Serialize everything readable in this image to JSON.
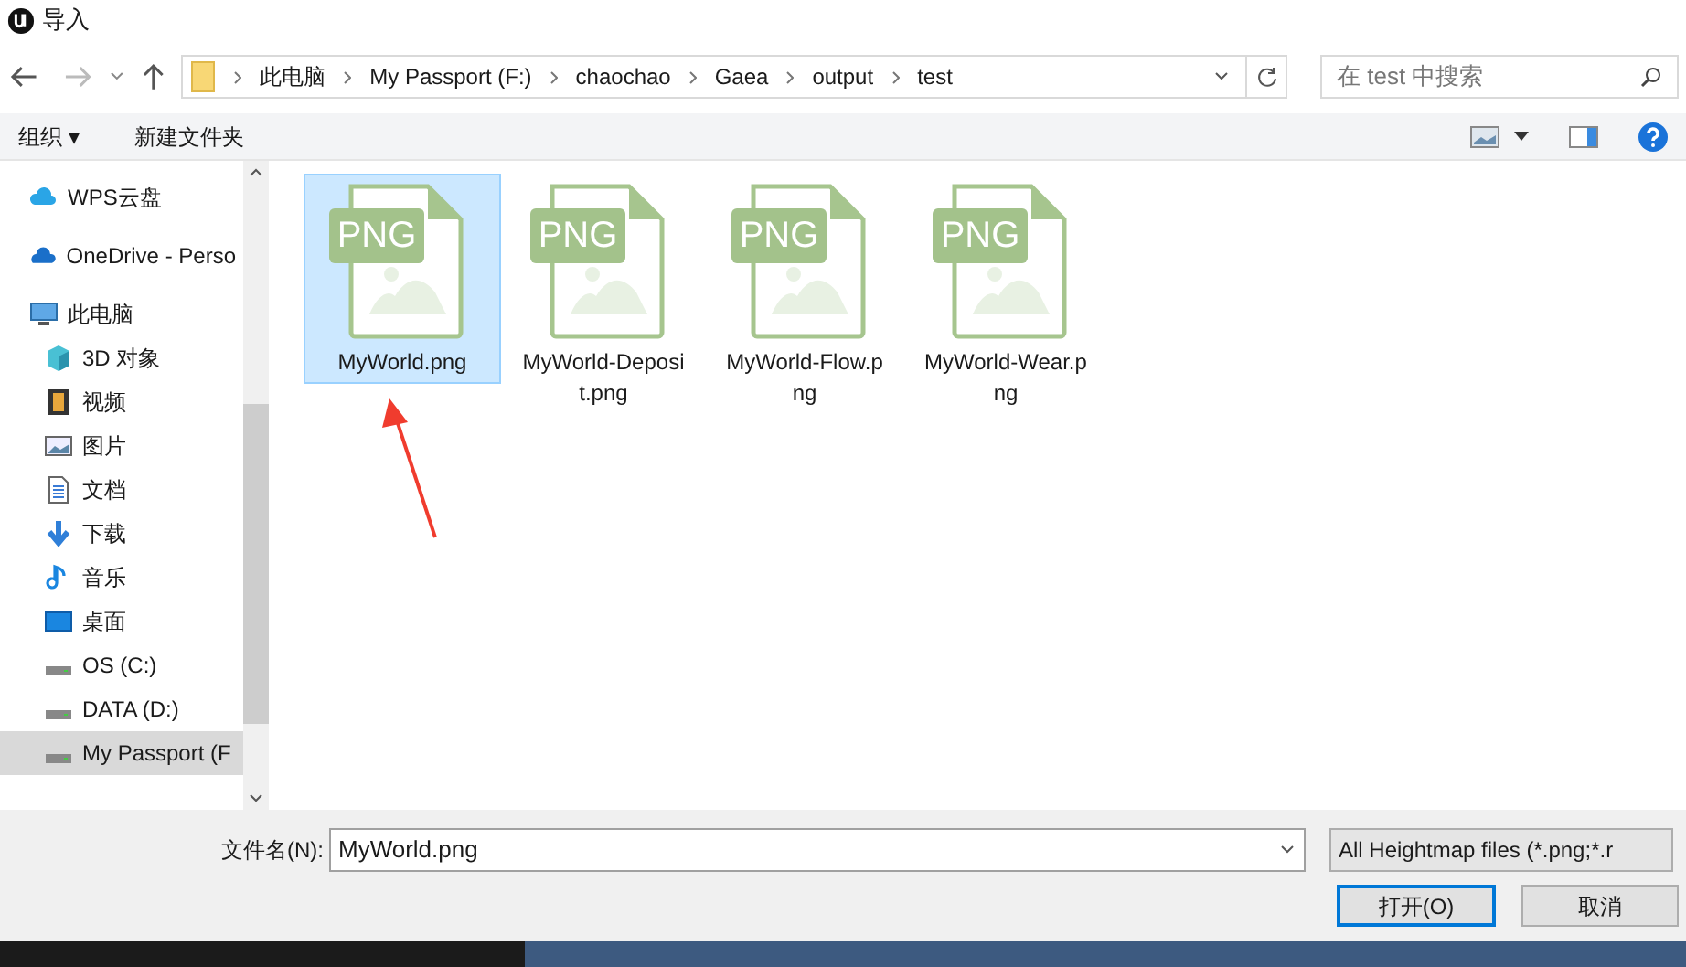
{
  "window": {
    "title": "导入"
  },
  "address_bar": {
    "path": [
      "此电脑",
      "My Passport (F:)",
      "chaochao",
      "Gaea",
      "output",
      "test"
    ]
  },
  "search": {
    "placeholder": "在 test 中搜索"
  },
  "toolbar": {
    "organize": "组织 ▾",
    "new_folder": "新建文件夹"
  },
  "sidebar": {
    "items": [
      {
        "label": "WPS云盘",
        "selected": false
      },
      {
        "label": "OneDrive - Perso",
        "selected": false
      },
      {
        "label": "此电脑",
        "selected": false,
        "children": [
          {
            "label": "3D 对象",
            "selected": false
          },
          {
            "label": "视频",
            "selected": false
          },
          {
            "label": "图片",
            "selected": false
          },
          {
            "label": "文档",
            "selected": false
          },
          {
            "label": "下载",
            "selected": false
          },
          {
            "label": "音乐",
            "selected": false
          },
          {
            "label": "桌面",
            "selected": false
          },
          {
            "label": "OS (C:)",
            "selected": false
          },
          {
            "label": "DATA (D:)",
            "selected": false
          },
          {
            "label": "My Passport (F",
            "selected": true
          }
        ]
      }
    ]
  },
  "files": [
    {
      "name": "MyWorld.png",
      "badge": "PNG",
      "selected": true
    },
    {
      "name": "MyWorld-Deposit.png",
      "badge": "PNG",
      "selected": false
    },
    {
      "name": "MyWorld-Flow.png",
      "badge": "PNG",
      "selected": false
    },
    {
      "name": "MyWorld-Wear.png",
      "badge": "PNG",
      "selected": false
    }
  ],
  "footer": {
    "filename_label": "文件名(N):",
    "filename": "MyWorld.png",
    "filter": "All Heightmap files (*.png;*.r",
    "open_button": "打开(O)",
    "cancel_button": "取消"
  }
}
